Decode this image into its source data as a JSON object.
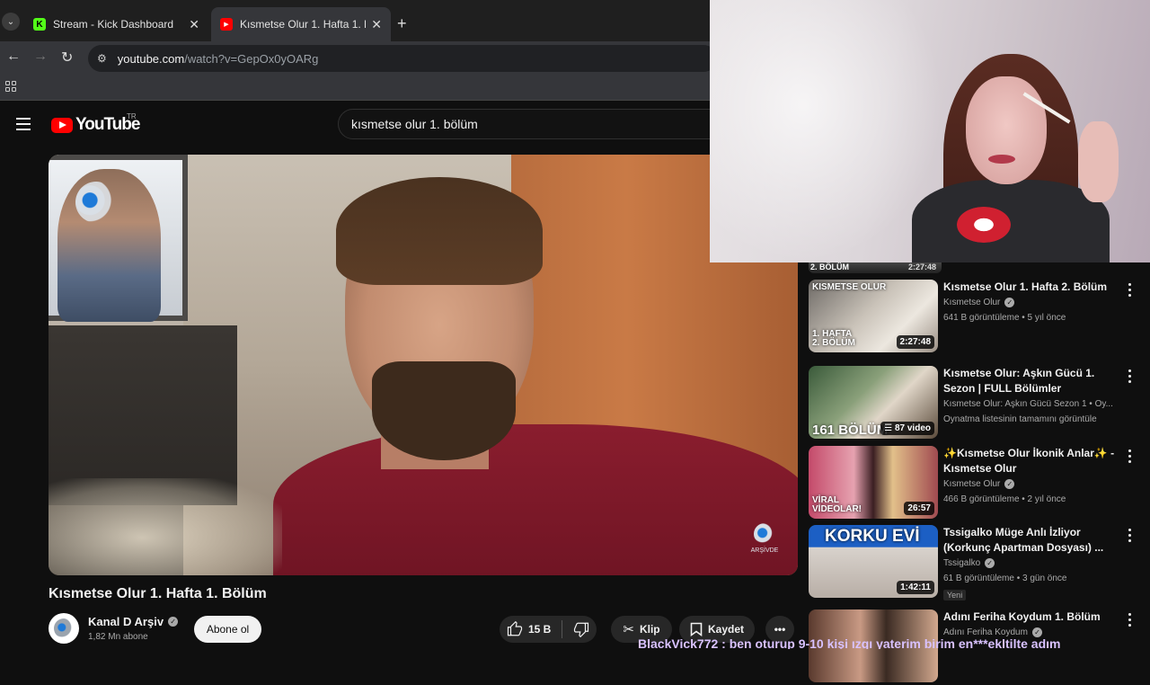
{
  "browser": {
    "tabs": [
      {
        "title": "Stream - Kick Dashboard",
        "favicon": "kick-icon",
        "active": false
      },
      {
        "title": "Kısmetse Olur 1. Hafta 1. Bölüm",
        "favicon": "youtube-icon",
        "active": true
      }
    ],
    "url_host": "youtube.com",
    "url_path": "/watch?v=GepOx0yOARg"
  },
  "youtube": {
    "logo_text": "YouTube",
    "country": "TR",
    "search_value": "kısmetse olur 1. bölüm"
  },
  "video": {
    "title": "Kısmetse Olur 1. Hafta 1. Bölüm",
    "watermark": "ARŞİVDE"
  },
  "channel": {
    "name": "Kanal D Arşiv",
    "subscribers": "1,82 Mn abone",
    "subscribe_label": "Abone ol"
  },
  "actions": {
    "likes": "15 B",
    "clip_label": "Klip",
    "save_label": "Kaydet"
  },
  "sidebar": {
    "partial": {
      "thumb_text": "2. BÖLÜM",
      "duration": "2:27:48"
    },
    "items": [
      {
        "thumb_text": "KISMETSE OLUR",
        "thumb_text2": "1. HAFTA 2. BÖLÜM",
        "duration": "2:27:48",
        "title": "Kısmetse Olur 1. Hafta 2. Bölüm",
        "channel": "Kısmetse Olur",
        "verified": true,
        "meta": "641 B görüntüleme • 5 yıl önce"
      },
      {
        "thumb_text": "161 BÖLÜM",
        "duration": "87 video",
        "title": "Kısmetse Olur: Aşkın Gücü 1. Sezon | FULL Bölümler",
        "channel": "Kısmetse Olur: Aşkın Gücü Sezon 1 • Oy...",
        "verified": false,
        "meta": "Oynatma listesinin tamamını görüntüle"
      },
      {
        "thumb_text": "VİRAL VİDEOLAR!",
        "duration": "26:57",
        "title": "✨Kısmetse Olur İkonik Anlar✨ - Kısmetse Olur",
        "channel": "Kısmetse Olur",
        "verified": true,
        "meta": "466 B görüntüleme • 2 yıl önce"
      },
      {
        "thumb_text": "KORKU EVİ",
        "duration": "1:42:11",
        "title": "Tssigalko Müge Anlı İzliyor (Korkunç Apartman Dosyası) ...",
        "channel": "Tssigalko",
        "verified": true,
        "meta": "61 B görüntüleme • 3 gün önce",
        "badge": "Yeni"
      },
      {
        "thumb_text": "",
        "duration": "",
        "title": "Adını Feriha Koydum 1. Bölüm",
        "channel": "Adını Feriha Koydum",
        "verified": true,
        "meta": ""
      }
    ]
  },
  "chat_overlay": "BlackVick772 : ben oturup 9-10 kişi ızgı yaterim birim en***ekltilte adım"
}
